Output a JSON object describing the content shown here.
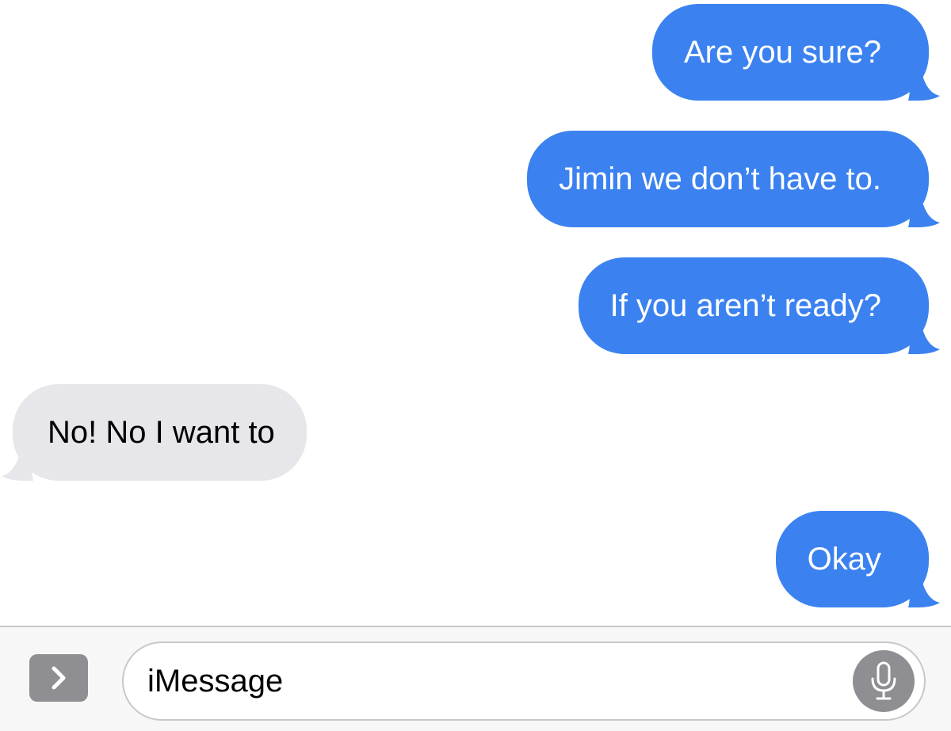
{
  "messages": [
    {
      "direction": "outgoing",
      "text": "Are you sure?"
    },
    {
      "direction": "outgoing",
      "text": "Jimin we don’t have to."
    },
    {
      "direction": "outgoing",
      "text": "If you aren’t ready?"
    },
    {
      "direction": "incoming",
      "text": "No! No I want to"
    },
    {
      "direction": "outgoing",
      "text": "Okay"
    }
  ],
  "composer": {
    "placeholder": "iMessage",
    "expand_icon": "chevron-right-icon",
    "mic_icon": "microphone-icon"
  },
  "colors": {
    "outgoing_bubble": "#3b82f0",
    "incoming_bubble": "#e6e6eb",
    "icon_gray": "#8e8e93"
  }
}
